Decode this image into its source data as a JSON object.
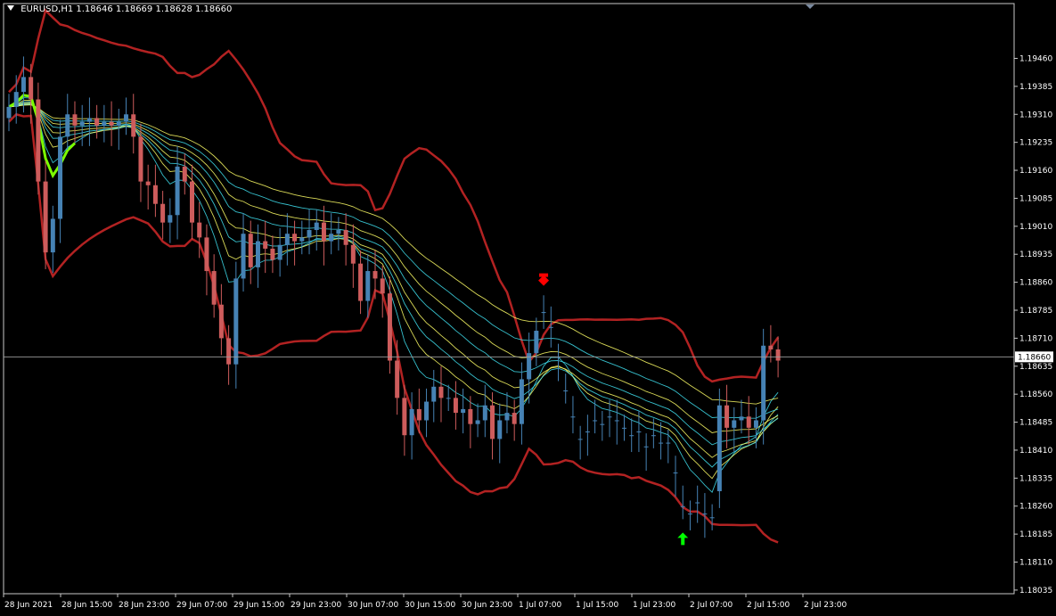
{
  "header": {
    "symbol": "EURUSD,H1",
    "ohlc": "1.18646 1.18669 1.18628 1.18660"
  },
  "price_label": "1.18660",
  "colors": {
    "background": "#000000",
    "frame": "#c8c8c8",
    "bull_candle": "#4682b4",
    "bear_candle": "#cd5c5c",
    "bollinger": "#b22222",
    "ribbon_yellow": "#ffff66",
    "ribbon_cyan": "#40e0f0",
    "ribbon_green": "#7cfc00",
    "sell_arrow": "#ff0000",
    "buy_arrow": "#00ff00",
    "price_line": "#a0a0a0"
  },
  "chart_data": {
    "type": "candlestick",
    "symbol": "EURUSD",
    "timeframe": "H1",
    "ylim": [
      1.1803,
      1.1954
    ],
    "y_ticks": [
      "1.19460",
      "1.19385",
      "1.19310",
      "1.19235",
      "1.19160",
      "1.19085",
      "1.19010",
      "1.18935",
      "1.18860",
      "1.18785",
      "1.18710",
      "1.18635",
      "1.18560",
      "1.18485",
      "1.18410",
      "1.18335",
      "1.18260",
      "1.18185",
      "1.18110",
      "1.18035"
    ],
    "x_ticks": [
      "28 Jun 2021",
      "28 Jun 15:00",
      "28 Jun 23:00",
      "29 Jun 07:00",
      "29 Jun 15:00",
      "29 Jun 23:00",
      "30 Jun 07:00",
      "30 Jun 15:00",
      "30 Jun 23:00",
      "1 Jul 07:00",
      "1 Jul 15:00",
      "1 Jul 23:00",
      "2 Jul 07:00",
      "2 Jul 15:00",
      "2 Jul 23:00"
    ],
    "current_price": 1.1866,
    "close": [
      1.1933,
      1.1937,
      1.1941,
      1.1935,
      1.1913,
      1.1894,
      1.1903,
      1.1925,
      1.1931,
      1.1928,
      1.1929,
      1.193,
      1.1928,
      1.1929,
      1.1928,
      1.1929,
      1.1931,
      1.1925,
      1.1913,
      1.1912,
      1.1907,
      1.1902,
      1.1904,
      1.1917,
      1.1913,
      1.1902,
      1.1898,
      1.1889,
      1.188,
      1.1871,
      1.1864,
      1.1887,
      1.1899,
      1.189,
      1.1897,
      1.1895,
      1.1892,
      1.1896,
      1.1899,
      1.1897,
      1.1898,
      1.19,
      1.1902,
      1.1897,
      1.1899,
      1.19,
      1.1896,
      1.1891,
      1.1881,
      1.1889,
      1.1887,
      1.1883,
      1.1865,
      1.1855,
      1.1845,
      1.1852,
      1.1849,
      1.1854,
      1.1858,
      1.1855,
      1.1855,
      1.1851,
      1.1852,
      1.1848,
      1.1849,
      1.1853,
      1.1844,
      1.1849,
      1.1851,
      1.1848,
      1.186,
      1.1867,
      1.1873,
      1.1878,
      1.1874,
      1.1866,
      1.1857,
      1.185,
      1.1844,
      1.1846,
      1.1849,
      1.1848,
      1.185,
      1.1849,
      1.1847,
      1.1845,
      1.1846,
      1.1842,
      1.1845,
      1.1843,
      1.1843,
      1.1835,
      1.1826,
      1.1824,
      1.1827,
      1.1824,
      1.1823,
      1.1853,
      1.1847,
      1.1849,
      1.185,
      1.1847,
      1.1849,
      1.1869,
      1.1868,
      1.1865
    ],
    "open": [
      1.193,
      1.1933,
      1.1937,
      1.1941,
      1.1935,
      1.1913,
      1.1894,
      1.1903,
      1.1925,
      1.1931,
      1.1928,
      1.1929,
      1.193,
      1.1928,
      1.1929,
      1.1928,
      1.1929,
      1.1931,
      1.1925,
      1.1913,
      1.1912,
      1.1907,
      1.1902,
      1.1904,
      1.1917,
      1.1913,
      1.1902,
      1.1898,
      1.1889,
      1.188,
      1.1871,
      1.1864,
      1.1887,
      1.1899,
      1.189,
      1.1897,
      1.1895,
      1.1892,
      1.1896,
      1.1899,
      1.1897,
      1.1898,
      1.19,
      1.1902,
      1.1897,
      1.1899,
      1.19,
      1.1896,
      1.1891,
      1.1881,
      1.1889,
      1.1887,
      1.1883,
      1.1865,
      1.1855,
      1.1845,
      1.1852,
      1.1849,
      1.1854,
      1.1858,
      1.1855,
      1.1855,
      1.1851,
      1.1852,
      1.1848,
      1.1849,
      1.1853,
      1.1844,
      1.1849,
      1.1851,
      1.1848,
      1.186,
      1.1867,
      1.1878,
      1.1874,
      1.1866,
      1.1857,
      1.185,
      1.1844,
      1.1846,
      1.1849,
      1.1848,
      1.185,
      1.1849,
      1.1847,
      1.1845,
      1.1846,
      1.1842,
      1.1845,
      1.1843,
      1.1843,
      1.1835,
      1.1826,
      1.1824,
      1.1827,
      1.1824,
      1.1823,
      1.183,
      1.1853,
      1.1847,
      1.1849,
      1.185,
      1.1847,
      1.1849,
      1.1869,
      1.1868
    ]
  },
  "signals": [
    {
      "type": "sell",
      "bar": 73
    },
    {
      "type": "buy",
      "bar": 92
    }
  ]
}
